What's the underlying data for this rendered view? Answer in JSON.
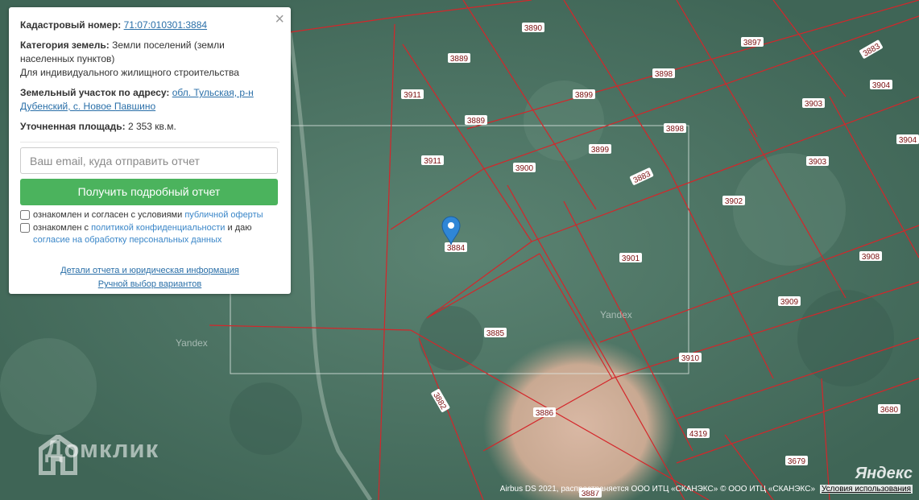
{
  "popup": {
    "cadastral_label": "Кадастровый номер:",
    "cadastral_value": "71:07:010301:3884",
    "category_label": "Категория земель:",
    "category_value_1": "Земли поселений (земли",
    "category_value_2": "населенных пунктов)",
    "category_value_3": "Для индивидуального жилищного строительства",
    "address_label": "Земельный участок по адресу:",
    "address_value_1": "обл. Тульская, р-н",
    "address_value_2": "Дубенский, с. Новое Павшино",
    "area_label": "Уточненная площадь:",
    "area_value": "2 353 кв.м.",
    "email_placeholder": "Ваш email, куда отправить отчет",
    "report_button": "Получить подробный отчет",
    "offer_text": "ознакомлен и согласен с условиями",
    "offer_link": "публичной оферты",
    "privacy_text_1": "ознакомлен с",
    "privacy_link": "политикой конфиденциальности",
    "privacy_text_2": "и даю",
    "consent_link": "согласие на обработку персональных данных",
    "details_link": "Детали отчета и юридическая информация",
    "manual_link": "Ручной выбор вариантов",
    "close_symbol": "×"
  },
  "map": {
    "plot_labels": [
      "3890",
      "3897",
      "3889",
      "3883",
      "3911",
      "3899",
      "3898",
      "3904",
      "3889",
      "3903",
      "3898",
      "3904",
      "3911",
      "3900",
      "3899",
      "3903",
      "3883",
      "3902",
      "3884",
      "3901",
      "3908",
      "3909",
      "3885",
      "3910",
      "3882",
      "3886",
      "3680",
      "4319",
      "3679",
      "3887"
    ],
    "watermark_1": "Yandex",
    "watermark_2": "Yandex",
    "brand": "Домклик",
    "yandex_logo": "Яндекс",
    "copyright": "Airbus DS 2021, распространяется ООО ИТЦ «СКАНЭКС» © ООО ИТЦ «СКАНЭКС»",
    "terms_link": "Условия использования",
    "marker_icon": "map-pin-icon",
    "colors": {
      "boundary": "#d4262a",
      "label_text": "#7a0f0f",
      "accent_button": "#4bb35d",
      "marker": "#2f86d6"
    }
  }
}
